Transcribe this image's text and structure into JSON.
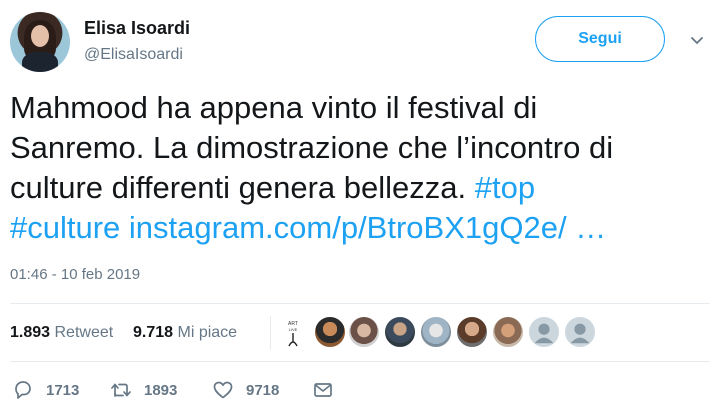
{
  "author": {
    "display_name": "Elisa Isoardi",
    "handle": "@ElisaIsoardi",
    "avatar_icon": "profile-photo"
  },
  "follow_label": "Segui",
  "tweet": {
    "text_line1": "Mahmood ha appena vinto il festival di",
    "text_line2": "Sanremo. La dimostrazione che l’incontro di",
    "text_line3": "culture differenti genera bellezza.",
    "hashtag1": "#top",
    "hashtag2": "#culture",
    "link": "instagram.com/p/BtroBX1gQ2e/",
    "ellipsis": "…",
    "timestamp": "01:46 - 10 feb 2019"
  },
  "stats": {
    "retweets": "1.893",
    "retweets_label": "Retweet",
    "likes": "9.718",
    "likes_label": "Mi piace"
  },
  "actions": {
    "replies": "1713",
    "retweets": "1893",
    "likes": "9718"
  },
  "colors": {
    "accent": "#1da1f2",
    "muted": "#657786",
    "text": "#14171a"
  }
}
